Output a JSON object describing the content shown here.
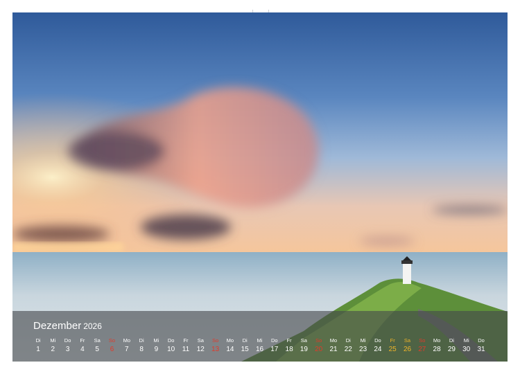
{
  "calendar": {
    "month": "Dezember",
    "year": "2026",
    "days": [
      {
        "wd": "Di",
        "n": "1",
        "t": "n"
      },
      {
        "wd": "Mi",
        "n": "2",
        "t": "n"
      },
      {
        "wd": "Do",
        "n": "3",
        "t": "n"
      },
      {
        "wd": "Fr",
        "n": "4",
        "t": "n"
      },
      {
        "wd": "Sa",
        "n": "5",
        "t": "n"
      },
      {
        "wd": "So",
        "n": "6",
        "t": "sun"
      },
      {
        "wd": "Mo",
        "n": "7",
        "t": "n"
      },
      {
        "wd": "Di",
        "n": "8",
        "t": "n"
      },
      {
        "wd": "Mi",
        "n": "9",
        "t": "n"
      },
      {
        "wd": "Do",
        "n": "10",
        "t": "n"
      },
      {
        "wd": "Fr",
        "n": "11",
        "t": "n"
      },
      {
        "wd": "Sa",
        "n": "12",
        "t": "n"
      },
      {
        "wd": "So",
        "n": "13",
        "t": "sun"
      },
      {
        "wd": "Mo",
        "n": "14",
        "t": "n"
      },
      {
        "wd": "Di",
        "n": "15",
        "t": "n"
      },
      {
        "wd": "Mi",
        "n": "16",
        "t": "n"
      },
      {
        "wd": "Do",
        "n": "17",
        "t": "n"
      },
      {
        "wd": "Fr",
        "n": "18",
        "t": "n"
      },
      {
        "wd": "Sa",
        "n": "19",
        "t": "n"
      },
      {
        "wd": "So",
        "n": "20",
        "t": "sun"
      },
      {
        "wd": "Mo",
        "n": "21",
        "t": "n"
      },
      {
        "wd": "Di",
        "n": "22",
        "t": "n"
      },
      {
        "wd": "Mi",
        "n": "23",
        "t": "n"
      },
      {
        "wd": "Do",
        "n": "24",
        "t": "n"
      },
      {
        "wd": "Fr",
        "n": "25",
        "t": "hol"
      },
      {
        "wd": "Sa",
        "n": "26",
        "t": "hol"
      },
      {
        "wd": "So",
        "n": "27",
        "t": "sun"
      },
      {
        "wd": "Mo",
        "n": "28",
        "t": "n"
      },
      {
        "wd": "Di",
        "n": "29",
        "t": "n"
      },
      {
        "wd": "Mi",
        "n": "30",
        "t": "n"
      },
      {
        "wd": "Do",
        "n": "31",
        "t": "n"
      }
    ]
  },
  "colors": {
    "sunday": "#e23a2a",
    "holiday": "#f0b429",
    "text": "#ffffff"
  }
}
